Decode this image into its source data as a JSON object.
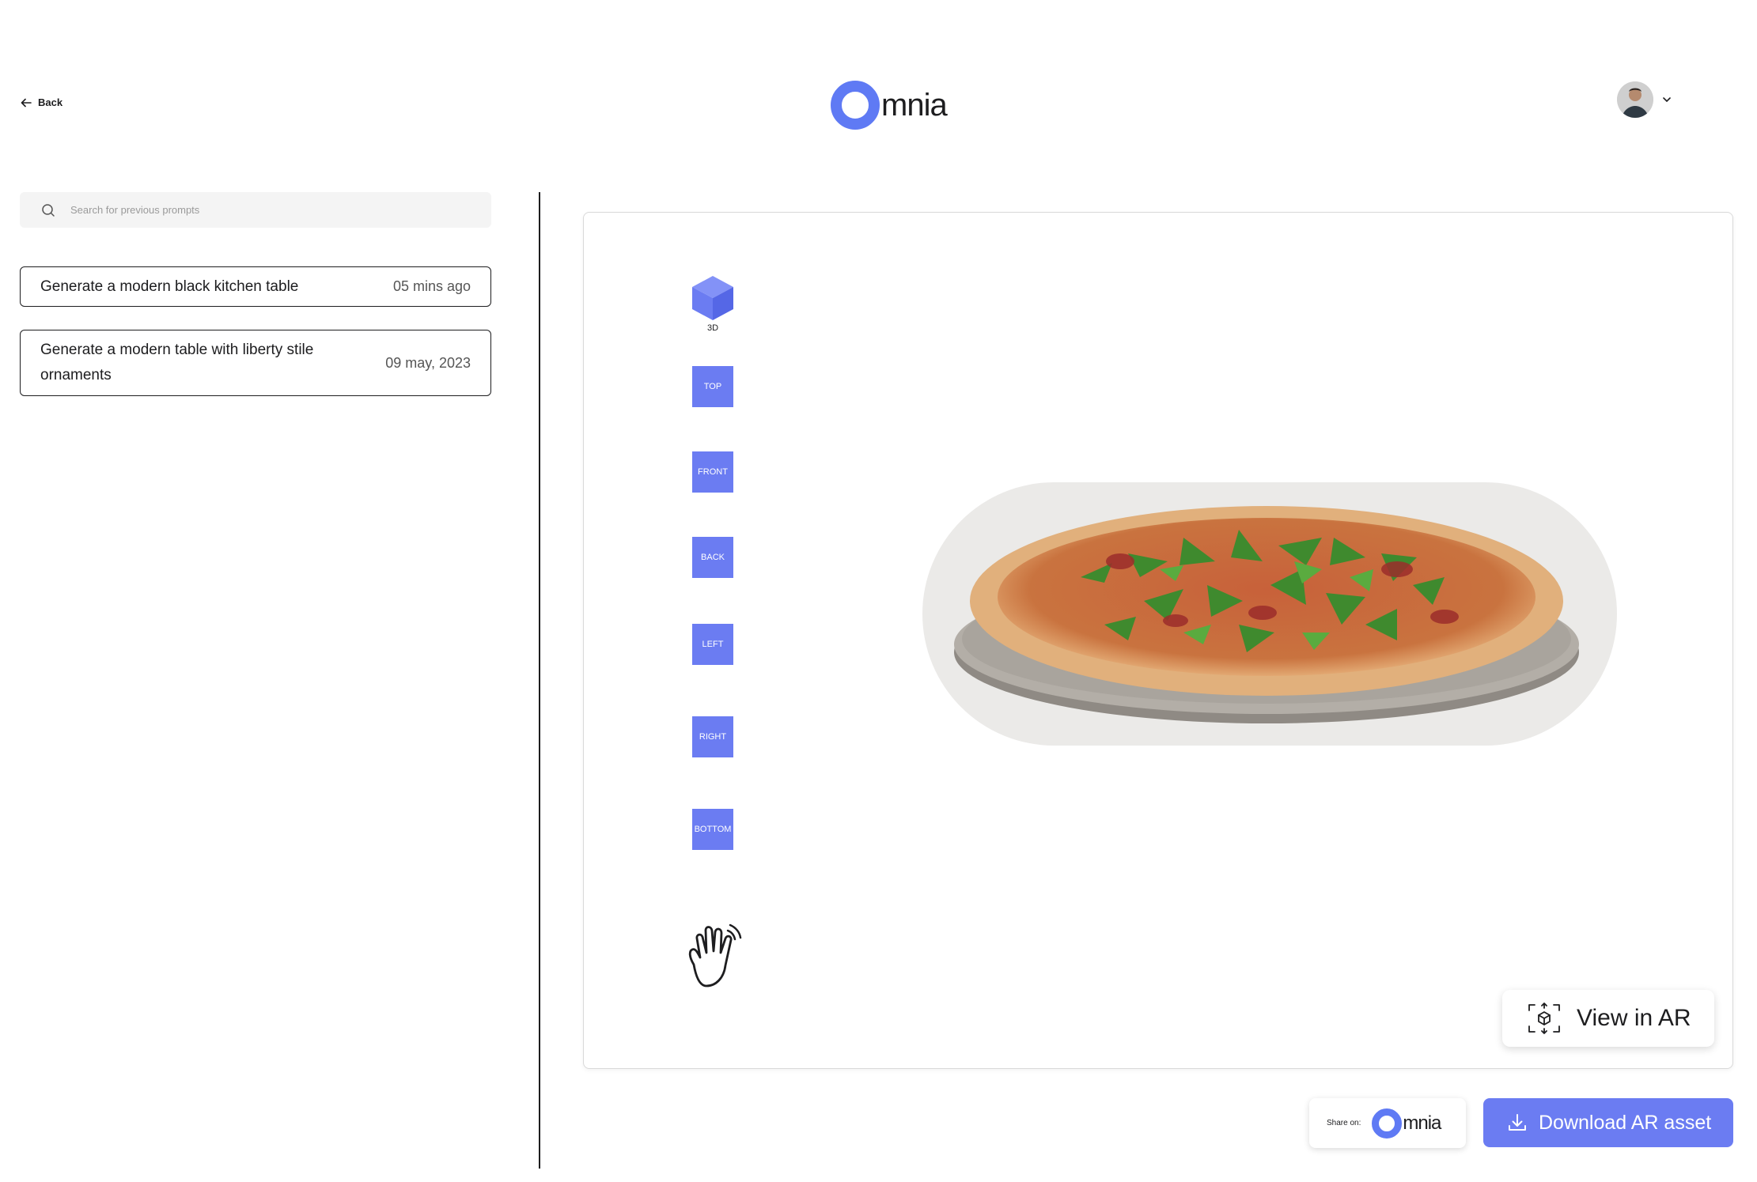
{
  "header": {
    "back_label": "Back",
    "logo_text": "mnia",
    "user_menu_icon": "chevron-down-icon"
  },
  "sidebar": {
    "search": {
      "placeholder": "Search for previous prompts",
      "value": ""
    },
    "prompts": [
      {
        "text": "Generate a modern black kitchen table",
        "time": "05 mins ago"
      },
      {
        "text": "Generate a modern table with liberty stile ornaments",
        "time": "09 may, 2023"
      }
    ]
  },
  "viewer": {
    "cube_label": "3D",
    "views": [
      "TOP",
      "FRONT",
      "BACK",
      "LEFT",
      "RIGHT",
      "BOTTOM"
    ],
    "pan_tool_icon": "hand-icon",
    "ar_button_label": "View in AR"
  },
  "footer": {
    "share_label": "Share on:",
    "share_logo_text": "mnia",
    "download_label": "Download AR asset"
  },
  "colors": {
    "accent": "#5f7af4",
    "view_button": "#6b7cf2",
    "text": "#1d1d1f"
  }
}
